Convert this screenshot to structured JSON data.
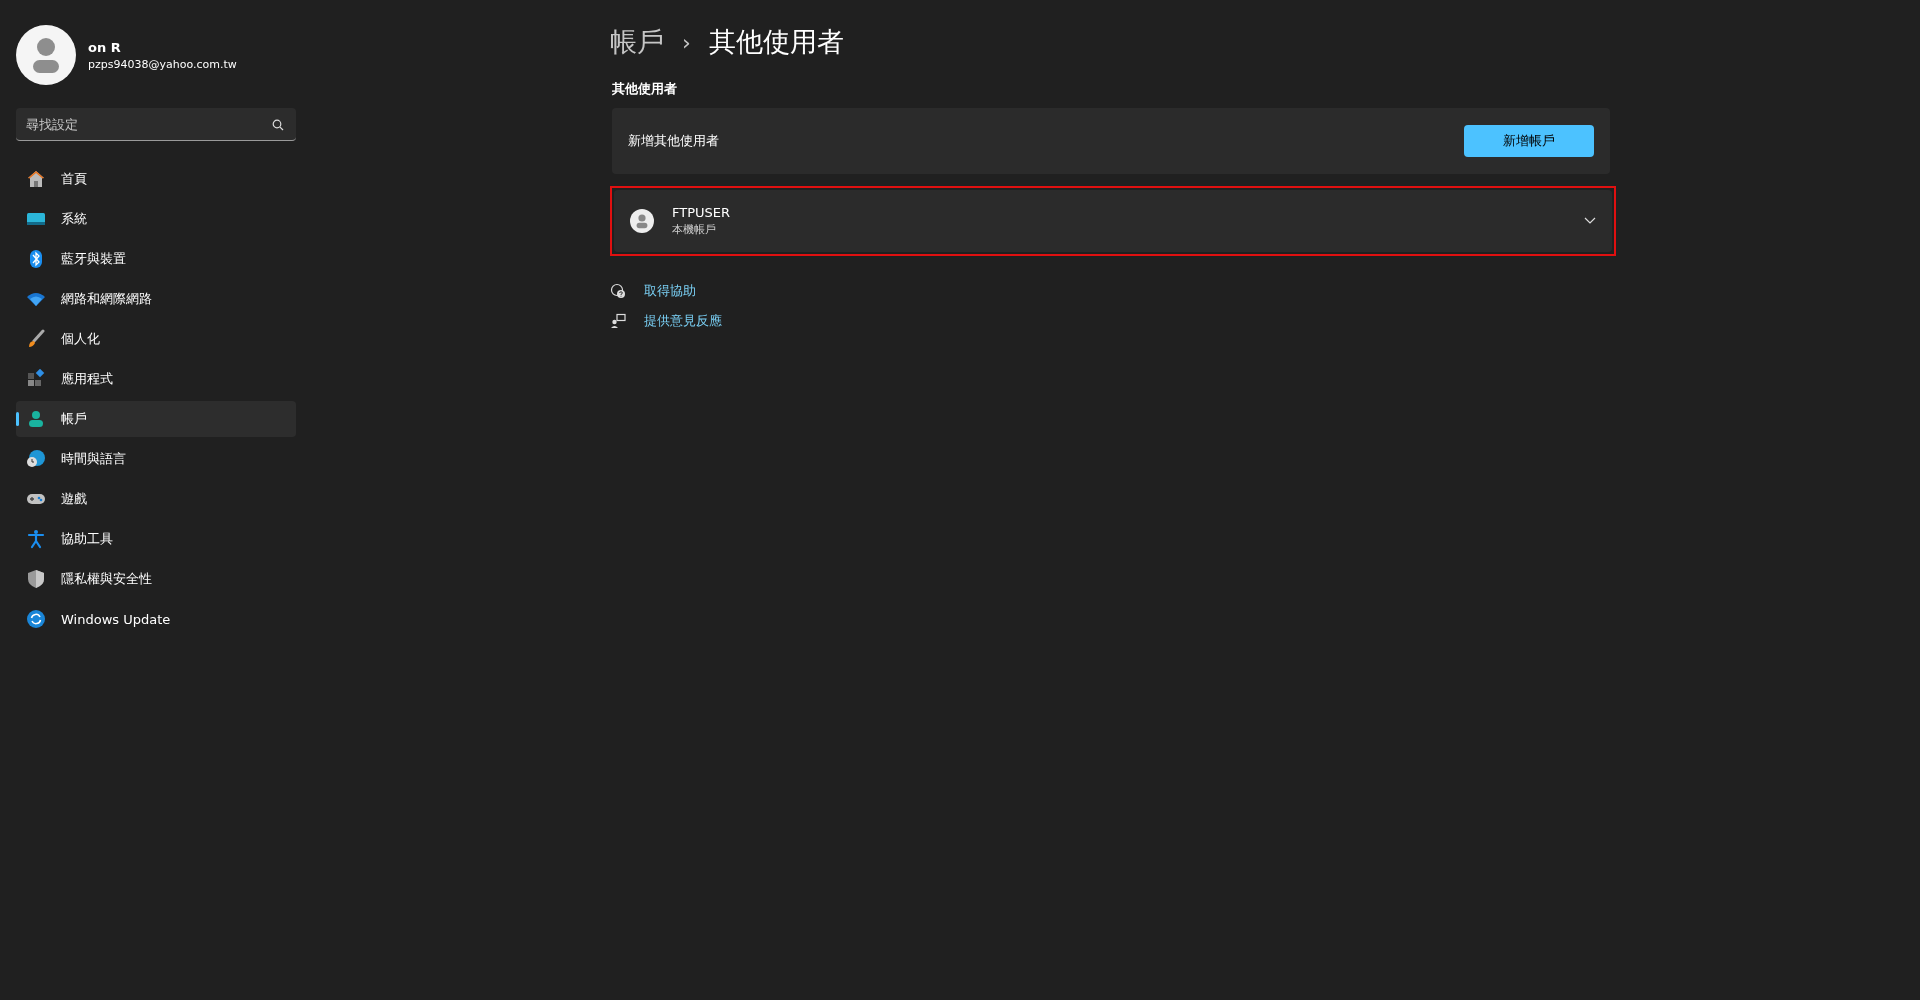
{
  "profile": {
    "name": "on R",
    "email": "pzps94038@yahoo.com.tw"
  },
  "search": {
    "placeholder": "尋找設定"
  },
  "nav": [
    {
      "label": "首頁",
      "selected": false
    },
    {
      "label": "系統",
      "selected": false
    },
    {
      "label": "藍牙與裝置",
      "selected": false
    },
    {
      "label": "網路和網際網路",
      "selected": false
    },
    {
      "label": "個人化",
      "selected": false
    },
    {
      "label": "應用程式",
      "selected": false
    },
    {
      "label": "帳戶",
      "selected": true
    },
    {
      "label": "時間與語言",
      "selected": false
    },
    {
      "label": "遊戲",
      "selected": false
    },
    {
      "label": "協助工具",
      "selected": false
    },
    {
      "label": "隱私權與安全性",
      "selected": false
    },
    {
      "label": "Windows Update",
      "selected": false
    }
  ],
  "breadcrumb": {
    "parent": "帳戶",
    "separator": "›",
    "current": "其他使用者"
  },
  "section_title": "其他使用者",
  "add_user": {
    "label": "新增其他使用者",
    "button": "新增帳戶"
  },
  "users": [
    {
      "name": "FTPUSER",
      "type": "本機帳戶",
      "expanded": false,
      "highlighted": true
    }
  ],
  "links": [
    {
      "label": "取得協助"
    },
    {
      "label": "提供意見反應"
    }
  ]
}
